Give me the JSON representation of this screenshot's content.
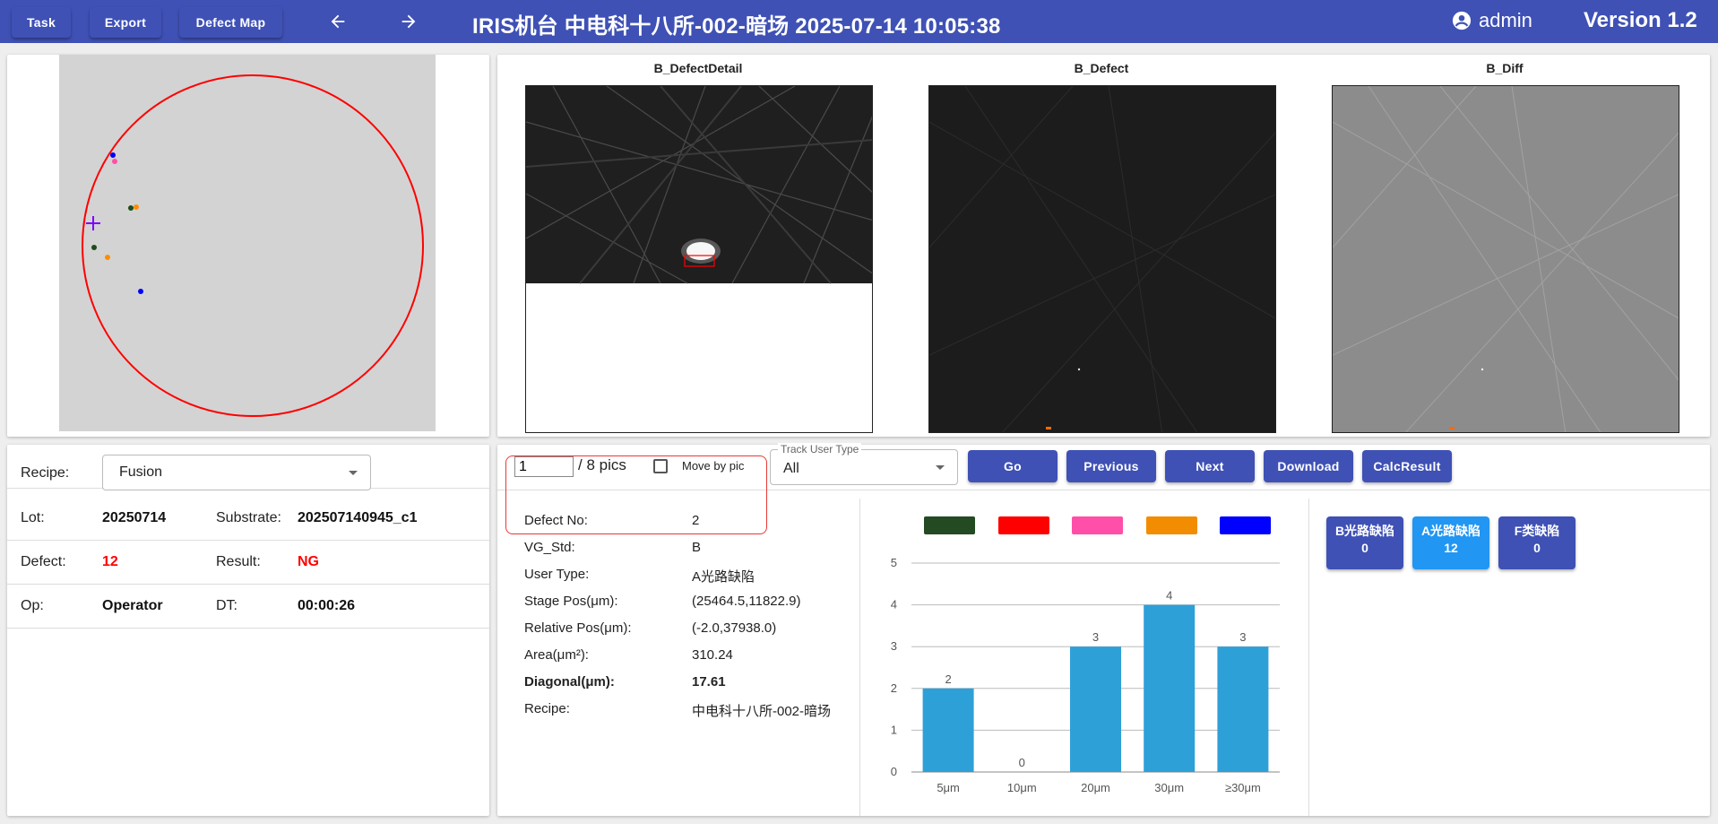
{
  "topbar": {
    "task_label": "Task",
    "export_label": "Export",
    "defect_map_label": "Defect Map",
    "title": "IRIS机台   中电科十八所-002-暗场   2025-07-14 10:05:38",
    "user": "admin",
    "version": "Version 1.2",
    "bg_color": "#3f51b5"
  },
  "wafer_map": {
    "outline_color": "#ff0000",
    "marker_color": "#8000ff",
    "defect_colors": [
      "#1b4d1b",
      "#ff8c00",
      "#ff4fa8",
      "#0000ff"
    ]
  },
  "images": {
    "detail_title": "B_DefectDetail",
    "defect_title": "B_Defect",
    "diff_title": "B_Diff"
  },
  "info": {
    "recipe_label": "Recipe:",
    "recipe_value": "Fusion",
    "lot_label": "Lot:",
    "lot_value": "20250714",
    "substrate_label": "Substrate:",
    "substrate_value": "202507140945_c1",
    "defect_label": "Defect:",
    "defect_value": "12",
    "result_label": "Result:",
    "result_value": "NG",
    "op_label": "Op:",
    "op_value": "Operator",
    "dt_label": "DT:",
    "dt_value": "00:00:26",
    "alert_color": "#ff0000"
  },
  "controls": {
    "pic_value": "1",
    "pic_total": "/ 8 pics",
    "move_by_pic_label": "Move by pic",
    "track_legend": "Track User Type",
    "track_value": "All",
    "go_label": "Go",
    "previous_label": "Previous",
    "next_label": "Next",
    "download_label": "Download",
    "calc_label": "CalcResult"
  },
  "defect_detail": {
    "defect_no_label": "Defect No:",
    "defect_no_value": "2",
    "vg_std_label": "VG_Std:",
    "vg_std_value": "B",
    "user_type_label": "User Type:",
    "user_type_value": "A光路缺陷",
    "stage_pos_label": "Stage Pos(μm):",
    "stage_pos_value": "(25464.5,11822.9)",
    "relative_pos_label": "Relative Pos(μm):",
    "relative_pos_value": "(-2.0,37938.0)",
    "area_label": "Area(μm²):",
    "area_value": "310.24",
    "diagonal_label": "Diagonal(μm):",
    "diagonal_value": "17.61",
    "recipe_label": "Recipe:",
    "recipe_value": "中电科十八所-002-暗场"
  },
  "legend_swatches": [
    "#234a23",
    "#ff0000",
    "#ff4fa8",
    "#f28c00",
    "#0000ff"
  ],
  "chart_data": {
    "type": "bar",
    "categories": [
      "5μm",
      "10μm",
      "20μm",
      "30μm",
      "≥30μm"
    ],
    "values": [
      2,
      0,
      3,
      4,
      3
    ],
    "ylim": [
      0,
      5
    ],
    "yticks": [
      "0",
      "1",
      "2",
      "3",
      "4",
      "5"
    ],
    "bar_color": "#2ea0d8",
    "grid": true
  },
  "categories": [
    {
      "name": "B光路缺陷",
      "count": "0",
      "color": "#3f51b5"
    },
    {
      "name": "A光路缺陷",
      "count": "12",
      "color": "#2196f3"
    },
    {
      "name": "F类缺陷",
      "count": "0",
      "color": "#3f51b5"
    }
  ]
}
